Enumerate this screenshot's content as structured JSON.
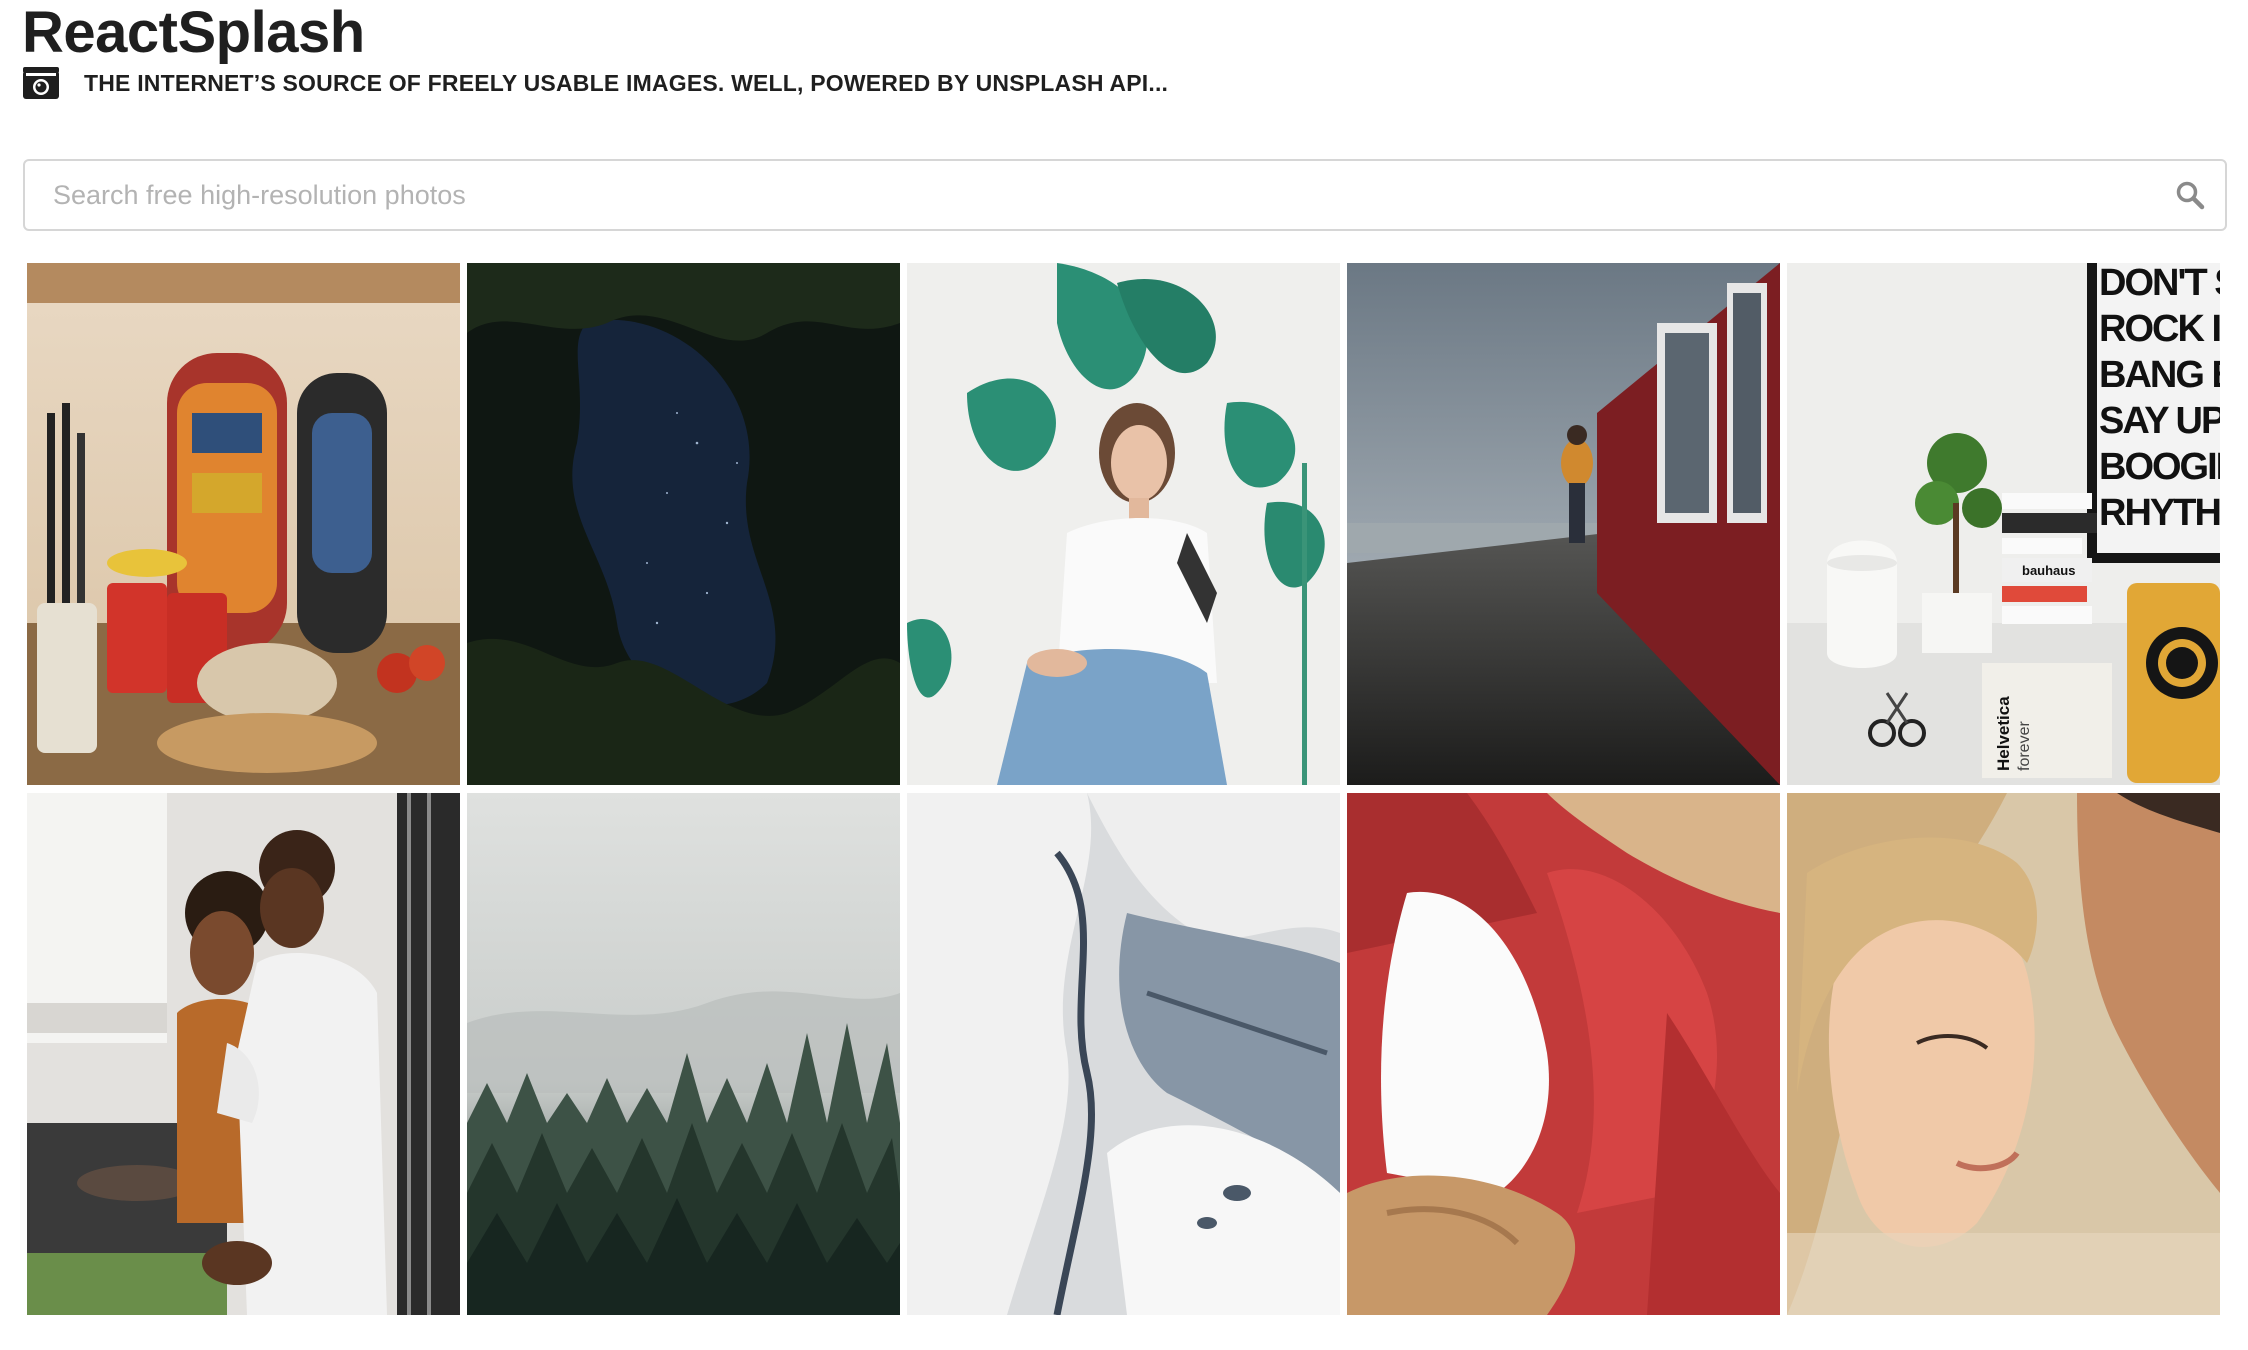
{
  "header": {
    "title": "ReactSplash",
    "tagline": "THE INTERNET’S SOURCE OF FREELY USABLE IMAGES. WELL, POWERED BY UNSPLASH API...",
    "logo_icon": "camera-icon"
  },
  "search": {
    "placeholder": "Search free high-resolution photos",
    "value": "",
    "button_icon": "search-icon"
  },
  "gallery": {
    "columns": 5,
    "photos": [
      {
        "name": "photo-kitchen-backpacks"
      },
      {
        "name": "photo-dark-forest-sky"
      },
      {
        "name": "photo-woman-monstera"
      },
      {
        "name": "photo-wet-boardwalk"
      },
      {
        "name": "photo-desk-bonsai-poster",
        "text_lines": [
          "DON'T STO",
          "ROCK IT T",
          "BANG BAN",
          "SAY UP JU",
          "BOOGIE TO",
          "RHYTHM O"
        ],
        "book_labels": [
          "bauhaus",
          "Helvetica",
          "forever"
        ]
      },
      {
        "name": "photo-couple-cooking"
      },
      {
        "name": "photo-misty-forest"
      },
      {
        "name": "photo-glacier-ice"
      },
      {
        "name": "photo-red-jacket"
      },
      {
        "name": "photo-couple-kiss"
      }
    ]
  }
}
